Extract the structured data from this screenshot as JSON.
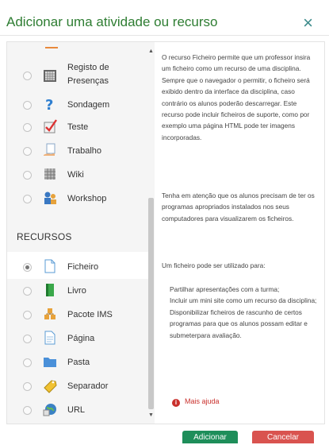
{
  "dialog": {
    "title": "Adicionar uma atividade ou recurso",
    "close_label": "×"
  },
  "options_top": [
    {
      "label": "Registo de\nPresenças",
      "icon": "attendance-register-icon"
    },
    {
      "label": "Sondagem",
      "icon": "question-mark-icon"
    },
    {
      "label": "Teste",
      "icon": "checklist-icon"
    },
    {
      "label": "Trabalho",
      "icon": "hand-document-icon"
    },
    {
      "label": "Wiki",
      "icon": "wiki-icon"
    },
    {
      "label": "Workshop",
      "icon": "workshop-people-icon"
    }
  ],
  "section": {
    "heading": "RECURSOS"
  },
  "resources": [
    {
      "label": "Ficheiro",
      "icon": "file-icon",
      "selected": true
    },
    {
      "label": "Livro",
      "icon": "book-icon",
      "selected": false
    },
    {
      "label": "Pacote IMS",
      "icon": "ims-package-icon",
      "selected": false
    },
    {
      "label": "Página",
      "icon": "page-icon",
      "selected": false
    },
    {
      "label": "Pasta",
      "icon": "folder-icon",
      "selected": false
    },
    {
      "label": "Separador",
      "icon": "label-tag-icon",
      "selected": false
    },
    {
      "label": "URL",
      "icon": "url-globe-icon",
      "selected": false
    }
  ],
  "help": {
    "paragraph1": "O recurso Ficheiro permite que um professor insira um ficheiro como um recurso de uma disciplina. Sempre que o navegador o permitir, o ficheiro será exibido dentro da interface da disciplina, caso contrário os alunos poderão descarregar. Este recurso pode incluir ficheiros de suporte, como por exemplo uma página HTML pode ter imagens incorporadas.",
    "paragraph2": "Tenha em atenção que os alunos precisam de ter os programas apropriados instalados nos seus computadores para visualizarem os ficheiros.",
    "paragraph3": "Um ficheiro pode ser utilizado para:",
    "uses": [
      "Partilhar apresentações com a turma;",
      "Incluir um mini site como um recurso da disciplina;",
      "Disponibilizar ficheiros de rascunho de certos programas para que os alunos possam editar e submeterpara avaliação."
    ],
    "more_help": "Mais ajuda"
  },
  "footer": {
    "add_label": "Adicionar",
    "cancel_label": "Cancelar"
  },
  "colors": {
    "title": "#2e7d32",
    "add_button": "#1e8e5a",
    "cancel_button": "#d9534f",
    "help_link": "#c9302c"
  }
}
